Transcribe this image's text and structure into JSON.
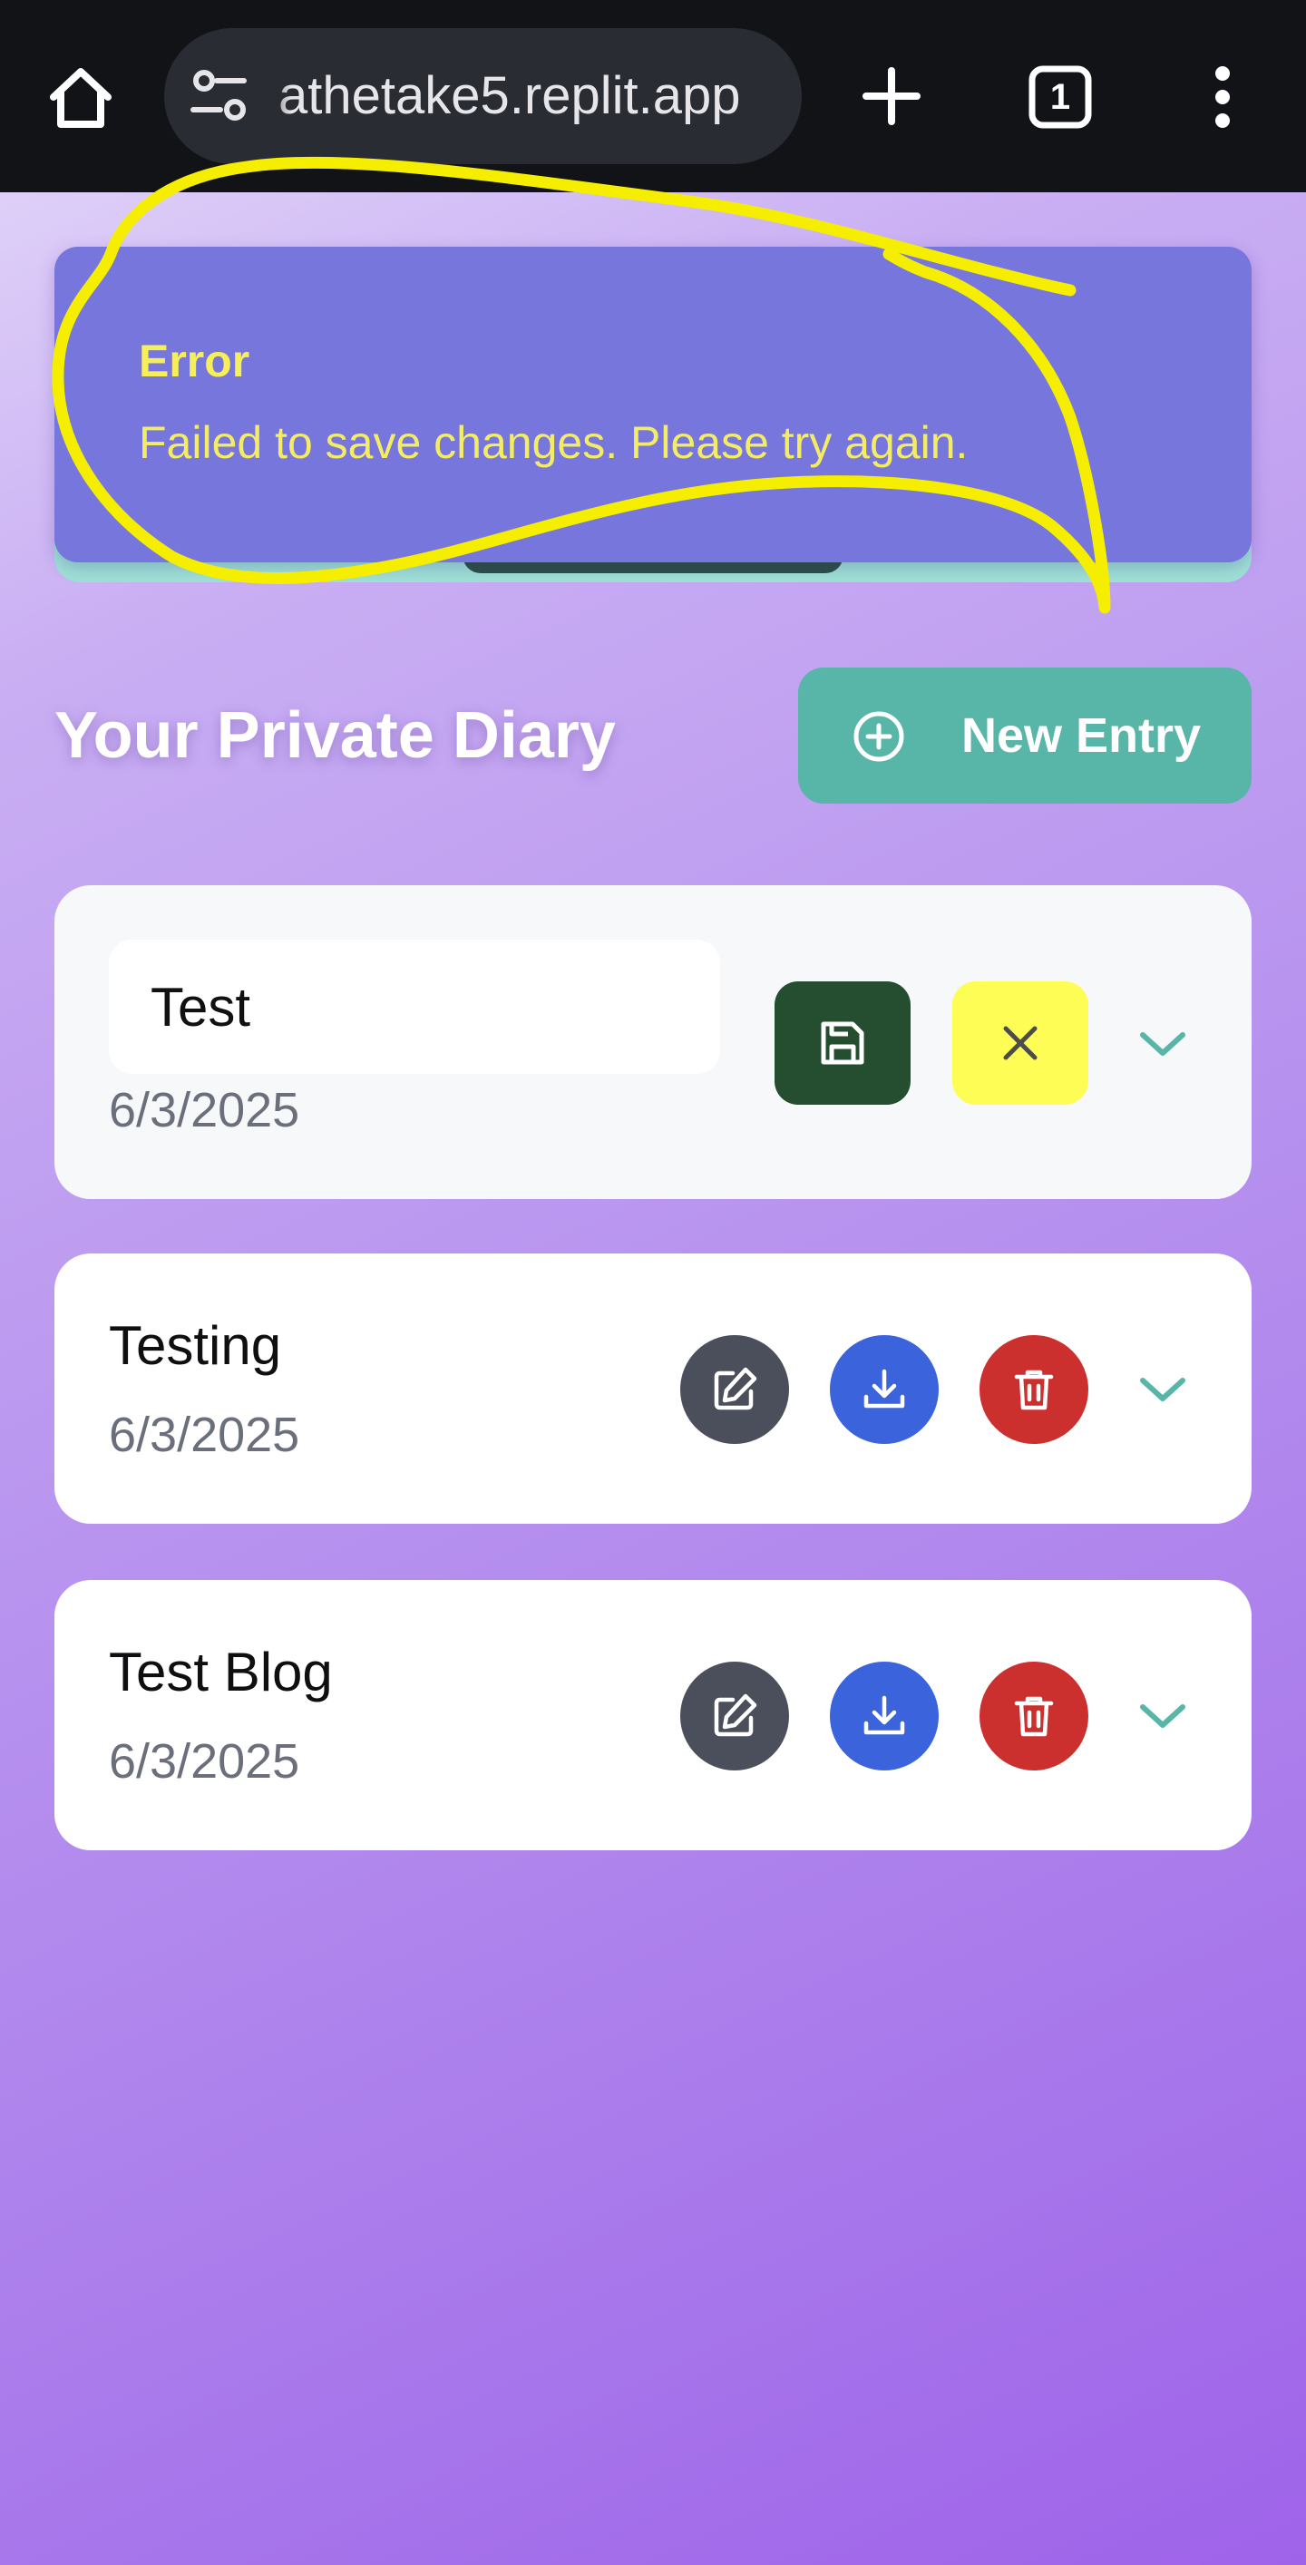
{
  "browser": {
    "url": "athetake5.replit.app",
    "tab_count": "1",
    "icons": {
      "home": "home-icon",
      "site_info": "site-settings-icon",
      "new_tab": "plus-icon",
      "tabs": "tab-switcher-icon",
      "menu": "more-vert-icon"
    }
  },
  "toast": {
    "title": "Error",
    "message": "Failed to save changes. Please try again."
  },
  "header": {
    "title": "Your Private Diary",
    "new_entry_label": "New Entry",
    "new_entry_icon": "plus-circle-icon"
  },
  "entries": [
    {
      "title": "Test",
      "date": "6/3/2025",
      "editing": true,
      "actions": [
        "save-icon",
        "close-icon",
        "chevron-down-icon"
      ]
    },
    {
      "title": "Testing",
      "date": "6/3/2025",
      "editing": false,
      "actions": [
        "edit-icon",
        "download-icon",
        "trash-icon",
        "chevron-down-icon"
      ]
    },
    {
      "title": "Test Blog",
      "date": "6/3/2025",
      "editing": false,
      "actions": [
        "edit-icon",
        "download-icon",
        "trash-icon",
        "chevron-down-icon"
      ]
    }
  ],
  "colors": {
    "toast_bg": "#7676dd",
    "toast_text": "#f4ec62",
    "accent_teal": "#58b6a8",
    "save_button": "#254d2f",
    "cancel_button": "#fdfd56",
    "edit_button": "#4b4f5c",
    "download_button": "#3a63dc",
    "delete_button": "#cb302e",
    "annotation": "#f5ee00"
  }
}
